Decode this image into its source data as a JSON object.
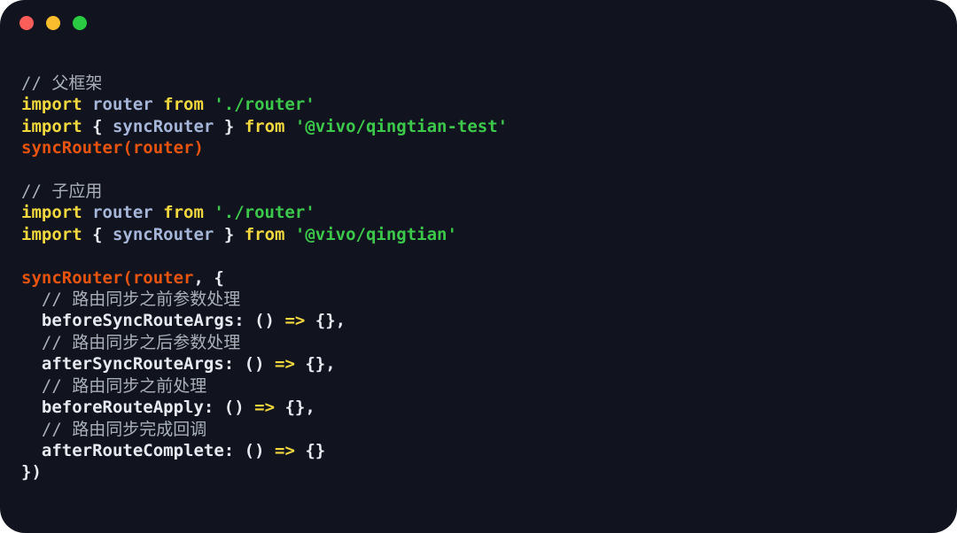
{
  "window": {
    "title_bar": {
      "buttons": [
        {
          "name": "close-button",
          "color": "#fb5d58",
          "label": ""
        },
        {
          "name": "minimize-button",
          "color": "#f9bd2e",
          "label": ""
        },
        {
          "name": "maximize-button",
          "color": "#2acb42",
          "label": ""
        }
      ]
    },
    "background_color": "#11141f"
  },
  "theme": {
    "comment": "#a9b0ba",
    "keyword": "#f2d83f",
    "identifier": "#a6b6d9",
    "string": "#3cc84a",
    "function": "#e8530e",
    "punctuation": "#e7eaf0",
    "arrow": "#f2d83f"
  },
  "code": {
    "language": "javascript",
    "lines": [
      {
        "id": "l1",
        "text": "// 父框架"
      },
      {
        "id": "l2",
        "text": "import router from './router'"
      },
      {
        "id": "l3",
        "text": "import { syncRouter } from '@vivo/qingtian-test'"
      },
      {
        "id": "l4",
        "text": "syncRouter(router)"
      },
      {
        "id": "l5",
        "text": ""
      },
      {
        "id": "l6",
        "text": "// 子应用"
      },
      {
        "id": "l7",
        "text": "import router from './router'"
      },
      {
        "id": "l8",
        "text": "import { syncRouter } from '@vivo/qingtian'"
      },
      {
        "id": "l9",
        "text": ""
      },
      {
        "id": "l10",
        "text": "syncRouter(router, {"
      },
      {
        "id": "l11",
        "text": "  // 路由同步之前参数处理"
      },
      {
        "id": "l12",
        "text": "  beforeSyncRouteArgs: () => {},"
      },
      {
        "id": "l13",
        "text": "  // 路由同步之后参数处理"
      },
      {
        "id": "l14",
        "text": "  afterSyncRouteArgs: () => {},"
      },
      {
        "id": "l15",
        "text": "  // 路由同步之前处理"
      },
      {
        "id": "l16",
        "text": "  beforeRouteApply: () => {},"
      },
      {
        "id": "l17",
        "text": "  // 路由同步完成回调"
      },
      {
        "id": "l18",
        "text": "  afterRouteComplete: () => {}"
      },
      {
        "id": "l19",
        "text": "})"
      }
    ],
    "tokens": {
      "l1": [
        [
          "comment",
          "// 父框架"
        ]
      ],
      "l2": [
        [
          "keyword",
          "import "
        ],
        [
          "ident",
          "router "
        ],
        [
          "keyword",
          "from "
        ],
        [
          "string",
          "'./router'"
        ]
      ],
      "l3": [
        [
          "keyword",
          "import "
        ],
        [
          "punct",
          "{ "
        ],
        [
          "ident",
          "syncRouter "
        ],
        [
          "punct",
          "} "
        ],
        [
          "keyword",
          "from "
        ],
        [
          "string",
          "'@vivo/qingtian-test'"
        ]
      ],
      "l4": [
        [
          "func",
          "syncRouter"
        ],
        [
          "func",
          "("
        ],
        [
          "func",
          "router"
        ],
        [
          "func",
          ")"
        ]
      ],
      "l5": [],
      "l6": [
        [
          "comment",
          "// 子应用"
        ]
      ],
      "l7": [
        [
          "keyword",
          "import "
        ],
        [
          "ident",
          "router "
        ],
        [
          "keyword",
          "from "
        ],
        [
          "string",
          "'./router'"
        ]
      ],
      "l8": [
        [
          "keyword",
          "import "
        ],
        [
          "punct",
          "{ "
        ],
        [
          "ident",
          "syncRouter "
        ],
        [
          "punct",
          "} "
        ],
        [
          "keyword",
          "from "
        ],
        [
          "string",
          "'@vivo/qingtian'"
        ]
      ],
      "l9": [],
      "l10": [
        [
          "func",
          "syncRouter"
        ],
        [
          "func",
          "("
        ],
        [
          "func",
          "router"
        ],
        [
          "punct",
          ", {"
        ]
      ],
      "l11": [
        [
          "plain",
          "  "
        ],
        [
          "comment",
          "// 路由同步之前参数处理"
        ]
      ],
      "l12": [
        [
          "plain",
          "  "
        ],
        [
          "prop",
          "beforeSyncRouteArgs"
        ],
        [
          "punct",
          ": () "
        ],
        [
          "arrow",
          "=>"
        ],
        [
          "punct",
          " {},"
        ]
      ],
      "l13": [
        [
          "plain",
          "  "
        ],
        [
          "comment",
          "// 路由同步之后参数处理"
        ]
      ],
      "l14": [
        [
          "plain",
          "  "
        ],
        [
          "prop",
          "afterSyncRouteArgs"
        ],
        [
          "punct",
          ": () "
        ],
        [
          "arrow",
          "=>"
        ],
        [
          "punct",
          " {},"
        ]
      ],
      "l15": [
        [
          "plain",
          "  "
        ],
        [
          "comment",
          "// 路由同步之前处理"
        ]
      ],
      "l16": [
        [
          "plain",
          "  "
        ],
        [
          "prop",
          "beforeRouteApply"
        ],
        [
          "punct",
          ": () "
        ],
        [
          "arrow",
          "=>"
        ],
        [
          "punct",
          " {},"
        ]
      ],
      "l17": [
        [
          "plain",
          "  "
        ],
        [
          "comment",
          "// 路由同步完成回调"
        ]
      ],
      "l18": [
        [
          "plain",
          "  "
        ],
        [
          "prop",
          "afterRouteComplete"
        ],
        [
          "punct",
          ": () "
        ],
        [
          "arrow",
          "=>"
        ],
        [
          "punct",
          " {}"
        ]
      ],
      "l19": [
        [
          "punct",
          "})"
        ]
      ]
    }
  }
}
